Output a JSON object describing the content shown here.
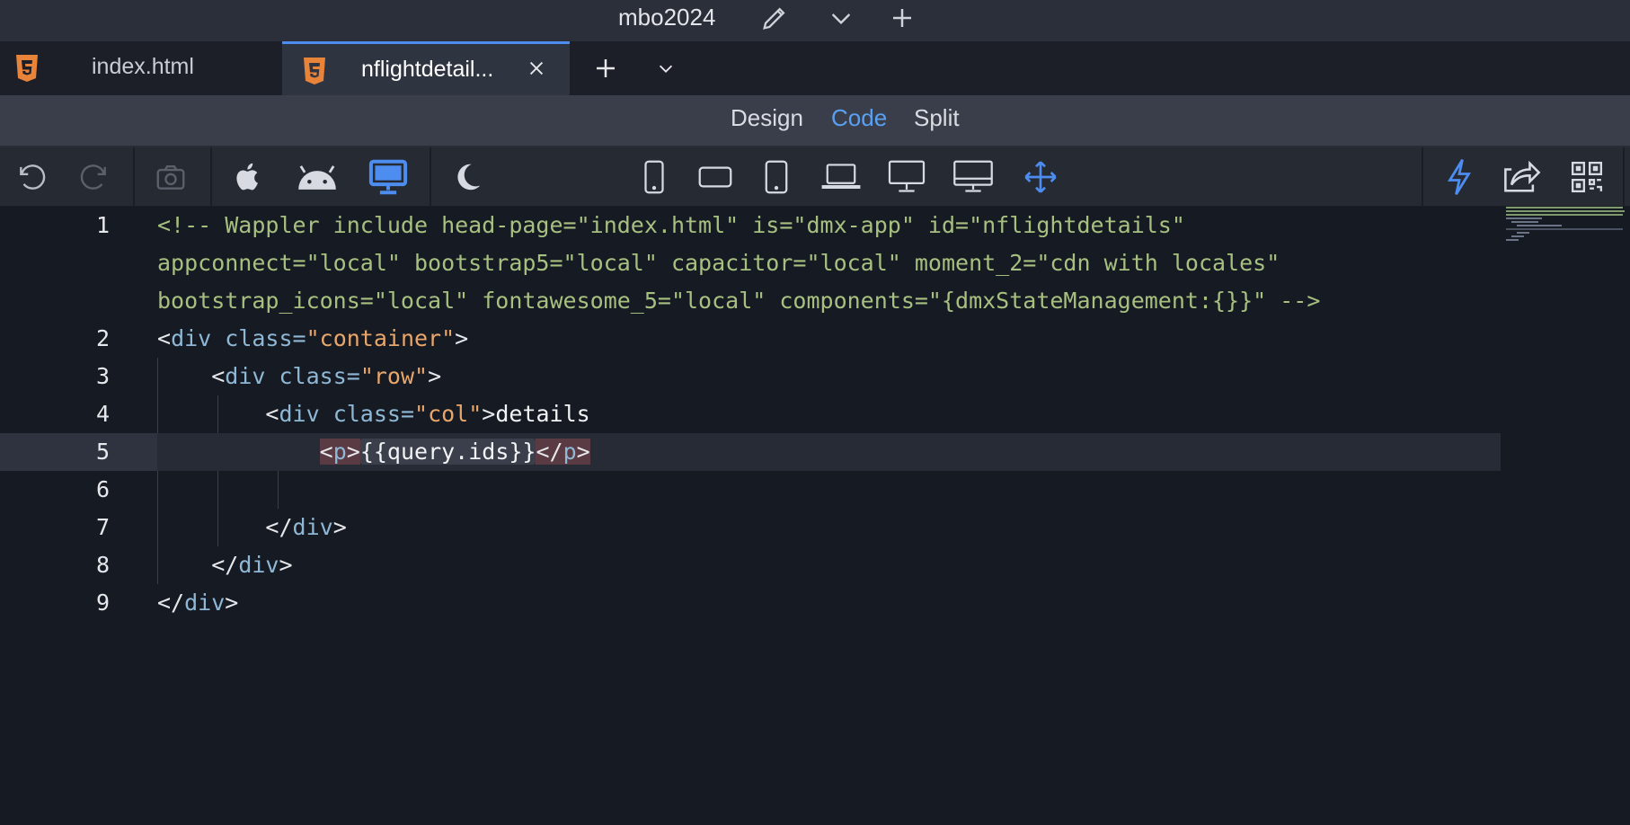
{
  "window": {
    "project_title": "mbo2024",
    "icons": [
      "pencil-icon",
      "chevron-down-icon",
      "plus-icon"
    ]
  },
  "tabs": [
    {
      "label": "index.html",
      "active": false,
      "icon": "html5-icon"
    },
    {
      "label": "nflightdetail...",
      "active": true,
      "icon": "html5-icon"
    }
  ],
  "tab_actions": [
    "close-icon",
    "new-tab-icon",
    "tab-list-chevron-icon"
  ],
  "view_modes": {
    "design": "Design",
    "code": "Code",
    "split": "Split",
    "active": "Code"
  },
  "toolbar": {
    "left": [
      "undo-icon",
      "redo-icon",
      "camera-icon",
      "apple-icon",
      "android-icon",
      "desktop-icon",
      "dark-mode-icon"
    ],
    "devices": [
      "phone-portrait-icon",
      "phone-landscape-icon",
      "tablet-icon",
      "laptop-icon",
      "desktop-monitor-icon",
      "large-monitor-icon",
      "resize-arrows-icon"
    ],
    "right": [
      "lightning-icon",
      "share-icon",
      "qr-code-icon"
    ]
  },
  "colors": {
    "accent": "#4d8df0",
    "html5_orange": "#e8833a",
    "comment": "#a7c080",
    "string": "#e8a66a",
    "tag": "#8fb8d6"
  },
  "editor": {
    "current_line": 5,
    "line_numbers": [
      "1",
      "2",
      "3",
      "4",
      "5",
      "6",
      "7",
      "8",
      "9"
    ],
    "comment_line_a": "<!-- Wappler include head-page=\"index.html\" is=\"dmx-app\" id=\"nflightdetails\"",
    "comment_line_b": "appconnect=\"local\" bootstrap5=\"local\" capacitor=\"local\" moment_2=\"cdn with locales\"",
    "comment_line_c": "bootstrap_icons=\"local\" fontawesome_5=\"local\" components=\"{dmxStateManagement:{}}\" -->",
    "tokens": {
      "lt": "<",
      "gt": ">",
      "lt_slash": "</",
      "div": "div",
      "p": "p",
      "class_eq": "class=",
      "container": "\"container\"",
      "row": "\"row\"",
      "col": "\"col\"",
      "details": "details",
      "expr": "{{query.ids}}"
    }
  }
}
